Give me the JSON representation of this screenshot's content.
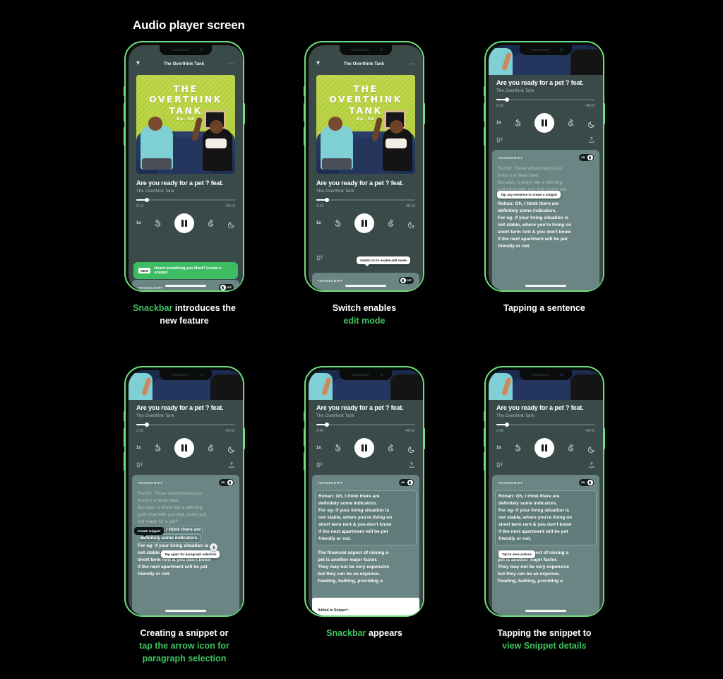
{
  "page": {
    "title": "Audio player screen",
    "accent_green": "#3ec45f",
    "frame_green": "#6ee07a",
    "background": "#000000",
    "snackbar_green": "#3dbd63"
  },
  "player": {
    "top_title": "The Overthink Tank",
    "chevron": "chevron-down-icon",
    "overflow": "...",
    "art_title_line1": "THE",
    "art_title_line2": "OVERTHINK",
    "art_title_line3": "TANK",
    "art_episode": "Ep. 08",
    "track_title": "Are you ready for a pet ? feat.",
    "track_subtitle": "The Overthink Tank",
    "speed": "1x",
    "rewind": "15",
    "forward": "15",
    "play_state": "pause-icon",
    "sleep": "moon-icon"
  },
  "transcript": {
    "label": "TRANSCRIPT",
    "toggle_off": "OFF",
    "toggle_on": "ON"
  },
  "screens": [
    {
      "id": "screen-1",
      "elapsed": "2:13",
      "remaining": "-46:13",
      "toggle_state": "OFF",
      "snackbar": {
        "badge": "NEW",
        "text": "Heard something you liked? Create a snippet"
      },
      "caption_parts": [
        {
          "text": "Snackbar",
          "green": true
        },
        {
          "text": " introduces the",
          "green": false
        },
        {
          "text": "new feature",
          "green": false,
          "newline": true
        }
      ]
    },
    {
      "id": "screen-2",
      "elapsed": "2:13",
      "remaining": "-46:13",
      "toggle_state": "OFF",
      "tooltip": "Switch on to enable edit mode",
      "caption_parts": [
        {
          "text": "Switch enables",
          "green": false
        },
        {
          "text": "edit mode",
          "green": true,
          "newline": true
        }
      ]
    },
    {
      "id": "screen-3",
      "elapsed": "2:25",
      "remaining": "-46:01",
      "toggle_state": "ON",
      "tooltip": "Tap any sentence to create a snippet",
      "caption_parts": [
        {
          "text": "Tapping a sentence",
          "green": false
        }
      ]
    },
    {
      "id": "screen-4",
      "elapsed": "2:35",
      "remaining": "-45:51",
      "toggle_state": "ON",
      "tooltip_dark": "Create snippet",
      "tooltip_white": "Tap again for paragraph selection",
      "caption_parts": [
        {
          "text": "Creating a snippet or",
          "green": false
        },
        {
          "text": "tap the arrow icon for",
          "green": true,
          "newline": true
        },
        {
          "text": "paragraph selection",
          "green": true,
          "newline": true
        }
      ]
    },
    {
      "id": "screen-5",
      "elapsed": "2:45",
      "remaining": "-45:41",
      "toggle_state": "ON",
      "snackbar_white": "Added to Snippets.",
      "caption_parts": [
        {
          "text": "Snackbar",
          "green": true
        },
        {
          "text": " appears",
          "green": false
        }
      ]
    },
    {
      "id": "screen-6",
      "elapsed": "2:45",
      "remaining": "-45:41",
      "toggle_state": "ON",
      "tooltip": "Tap to view actions",
      "caption_parts": [
        {
          "text": "Tapping the snippet to",
          "green": false
        },
        {
          "text": "view Snippet details",
          "green": true,
          "newline": true
        }
      ]
    }
  ],
  "transcript_text": {
    "p1_l1": "Surbhi: Those attachments just",
    "p1_l2": "form in a heart beat.",
    "p1_l3": "But also, is there like a defining",
    "p1_l4": "point that tells you that you're just",
    "p1_l5": "not ready for a pet?",
    "p2_l1": "Rohan: Oh, I think there are",
    "p2_l2": "definitely some indicators.",
    "p2_l3": "For eg- if your living situation is",
    "p2_l4": "not stable, where you're living on",
    "p2_l5": "short term rent & you don't know",
    "p2_l6": "if the next apartment will be pet",
    "p2_l7": "friendly or not.",
    "p3_l1": "The financial aspect of raising a",
    "p3_l2": "pet is another major factor.",
    "p3_l3": "They may not be very expensive",
    "p3_l4": "but they can be an expense.",
    "p3_l5": "Feeding, bathing, providing a"
  },
  "captions": {
    "c1_a": "Snackbar",
    "c1_b": " introduces the",
    "c1_c": "new feature",
    "c2_a": "Switch enables",
    "c2_b": "edit mode",
    "c3_a": "Tapping a sentence",
    "c4_a": "Creating a snippet or",
    "c4_b": "tap the arrow icon for",
    "c4_c": "paragraph selection",
    "c5_a": "Snackbar",
    "c5_b": " appears",
    "c6_a": "Tapping the snippet to",
    "c6_b": "view Snippet details"
  }
}
